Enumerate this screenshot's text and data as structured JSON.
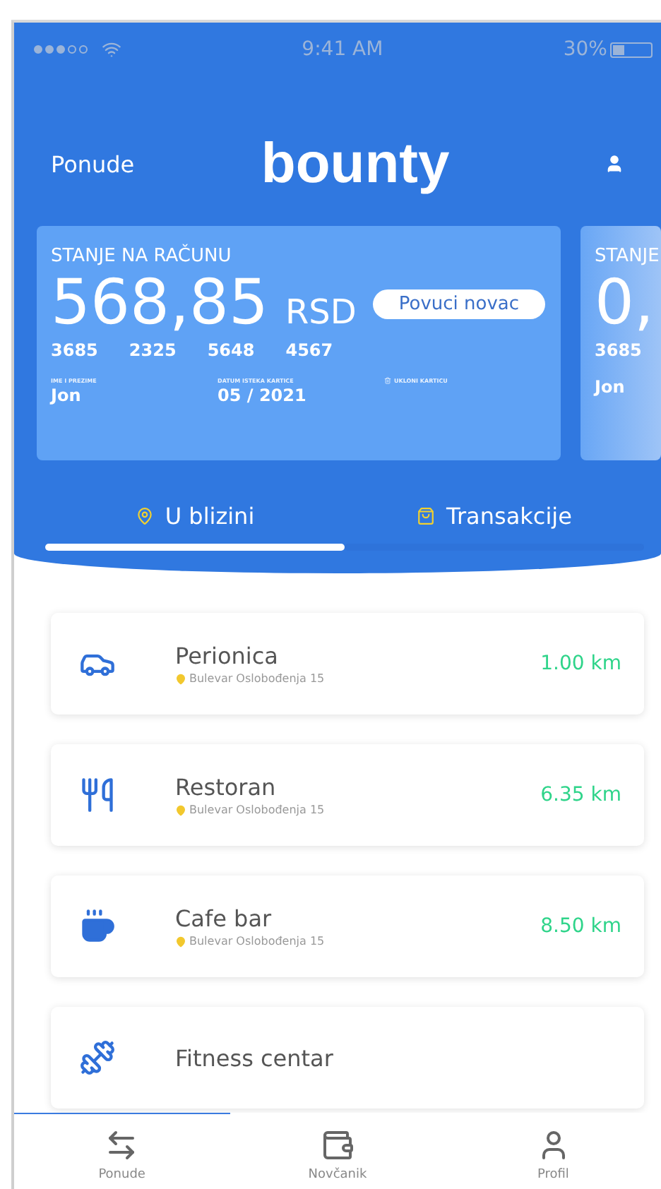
{
  "status_bar": {
    "time": "9:41 AM",
    "battery": "30%"
  },
  "header": {
    "left_link": "Ponude",
    "logo": "bounty"
  },
  "cards": [
    {
      "kind": "full",
      "label": "STANJE NA RAČUNU",
      "amount": "568,85",
      "currency": "RSD",
      "button": "Povuci novac",
      "number": [
        "3685",
        "2325",
        "5648",
        "4567"
      ],
      "fields": [
        {
          "label": "IME I PREZIME",
          "value": "Jon"
        },
        {
          "label": "DATUM ISTEKA KARTICE",
          "value": "05 / 2021"
        },
        {
          "label": "UKLONI KARTICU"
        }
      ]
    },
    {
      "kind": "partial",
      "label": "STANJE",
      "amount": "0,",
      "number": [
        "3685"
      ],
      "fields": [
        {
          "value": "Jon"
        }
      ]
    }
  ],
  "tabs": [
    {
      "label": "U blizini",
      "selected": true
    },
    {
      "label": "Transakcije",
      "selected": false
    }
  ],
  "places": [
    {
      "name": "Perionica",
      "address": "Bulevar Oslobođenja 15",
      "distance": "1.00 km"
    },
    {
      "name": "Restoran",
      "address": "Bulevar Oslobođenja 15",
      "distance": "6.35 km"
    },
    {
      "name": "Cafe bar",
      "address": "Bulevar Oslobođenja 15",
      "distance": "8.50 km"
    },
    {
      "name": "Fitness centar"
    }
  ],
  "nav": [
    {
      "label": "Ponude",
      "selected": true
    },
    {
      "label": "Novčanik",
      "selected": false
    },
    {
      "label": "Profil",
      "selected": false
    }
  ]
}
